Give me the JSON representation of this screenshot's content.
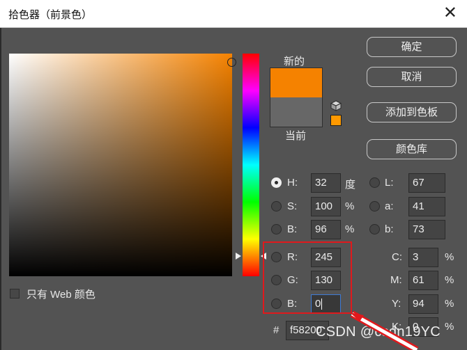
{
  "window": {
    "title": "拾色器（前景色）"
  },
  "preview": {
    "new_label": "新的",
    "current_label": "当前",
    "new_color": "#f58200",
    "current_color": "#676767"
  },
  "buttons": {
    "ok": "确定",
    "cancel": "取消",
    "add_to_swatches": "添加到色板",
    "color_libraries": "颜色库"
  },
  "hsb": {
    "h": {
      "label": "H:",
      "value": "32",
      "unit": "度"
    },
    "s": {
      "label": "S:",
      "value": "100",
      "unit": "%"
    },
    "b": {
      "label": "B:",
      "value": "96",
      "unit": "%"
    }
  },
  "rgb": {
    "r": {
      "label": "R:",
      "value": "245"
    },
    "g": {
      "label": "G:",
      "value": "130"
    },
    "b": {
      "label": "B:",
      "value": "0"
    }
  },
  "lab": {
    "l": {
      "label": "L:",
      "value": "67"
    },
    "a": {
      "label": "a:",
      "value": "41"
    },
    "b": {
      "label": "b:",
      "value": "73"
    }
  },
  "cmyk": {
    "c": {
      "label": "C:",
      "value": "3",
      "unit": "%"
    },
    "m": {
      "label": "M:",
      "value": "61",
      "unit": "%"
    },
    "y": {
      "label": "Y:",
      "value": "94",
      "unit": "%"
    },
    "k": {
      "label": "K:",
      "value": "0",
      "unit": "%"
    }
  },
  "hex": {
    "label": "#",
    "value": "f58200"
  },
  "web_only": {
    "label": "只有 Web 颜色"
  },
  "watermark": "CSDN @csdn19YC"
}
